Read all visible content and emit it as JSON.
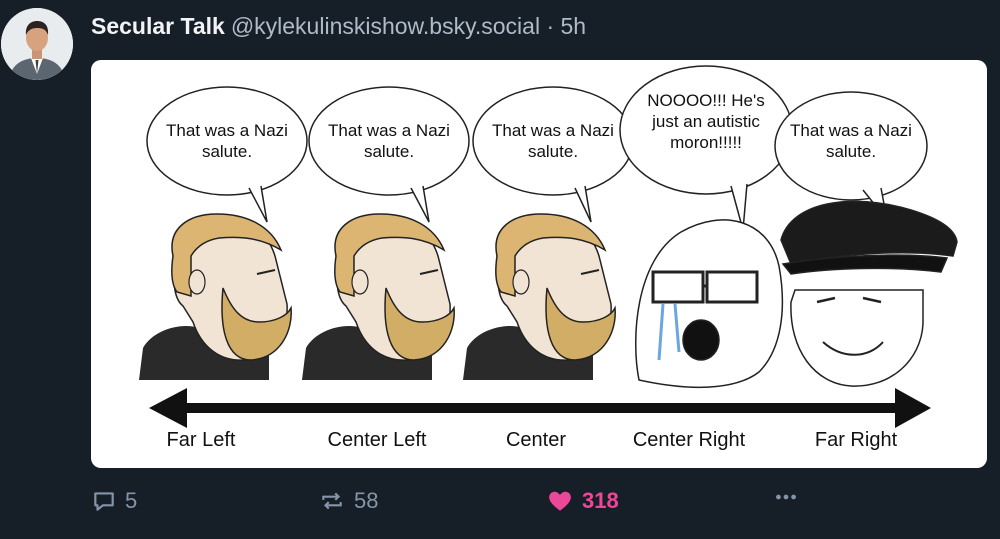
{
  "post": {
    "author_name": "Secular Talk",
    "author_handle": "@kylekulinskishow.bsky.social",
    "time": "· 5h"
  },
  "meme": {
    "bubbles": [
      {
        "text": "That was a Nazi salute."
      },
      {
        "text": "That was a Nazi salute."
      },
      {
        "text": "That was a Nazi salute."
      },
      {
        "text": "NOOOO!!! He's just an autistic moron!!!!!"
      },
      {
        "text": "That was a Nazi salute."
      }
    ],
    "axis_labels": [
      "Far Left",
      "Center Left",
      "Center",
      "Center Right",
      "Far Right"
    ]
  },
  "actions": {
    "reply_count": "5",
    "repost_count": "58",
    "like_count": "318",
    "like_color": "#ec4899",
    "more_icon": "ellipsis-icon"
  },
  "icons": {
    "reply": "speech-bubble-icon",
    "repost": "repost-arrows-icon",
    "like": "heart-icon"
  }
}
